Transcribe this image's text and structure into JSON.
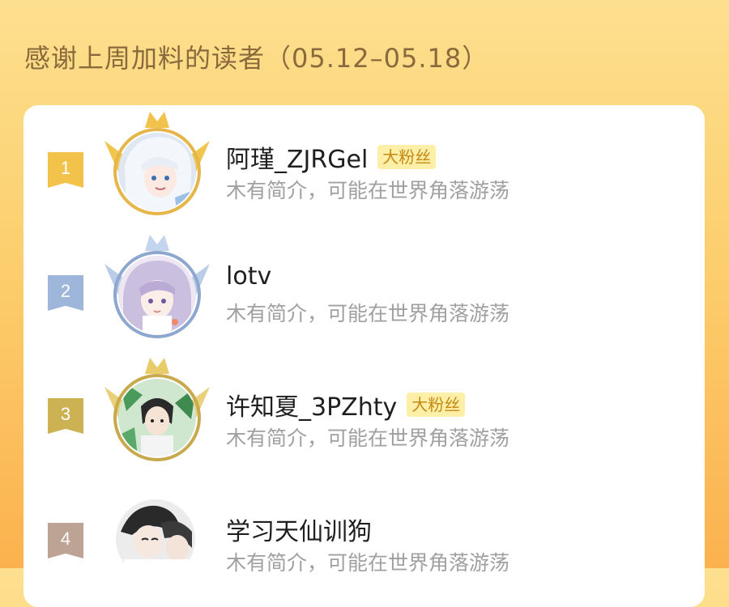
{
  "header": {
    "title": "感谢上周加料的读者（05.12–05.18）"
  },
  "colors": {
    "gold": "#e7b64a",
    "silver": "#8ea7cf",
    "bronze": "#c9a94d",
    "fourth": "#b69c88"
  },
  "readers": [
    {
      "rank": "1",
      "name": "阿瑾_ZJRGel",
      "badge": "大粉丝",
      "bio": "木有简介，可能在世界角落游荡",
      "frame": "gold",
      "avatar_icon": "anime-white-hair-avatar-icon"
    },
    {
      "rank": "2",
      "name": "lotv",
      "badge": "",
      "bio": "木有简介，可能在世界角落游荡",
      "frame": "silver",
      "avatar_icon": "anime-lilac-hair-avatar-icon"
    },
    {
      "rank": "3",
      "name": "许知夏_3PZhty",
      "badge": "大粉丝",
      "bio": "木有简介，可能在世界角落游荡",
      "frame": "bronze",
      "avatar_icon": "anime-dark-hair-leaves-avatar-icon"
    },
    {
      "rank": "4",
      "name": "学习天仙训狗",
      "badge": "",
      "bio": "木有简介，可能在世界角落游荡",
      "frame": "none",
      "avatar_icon": "anime-two-boys-avatar-icon"
    }
  ]
}
